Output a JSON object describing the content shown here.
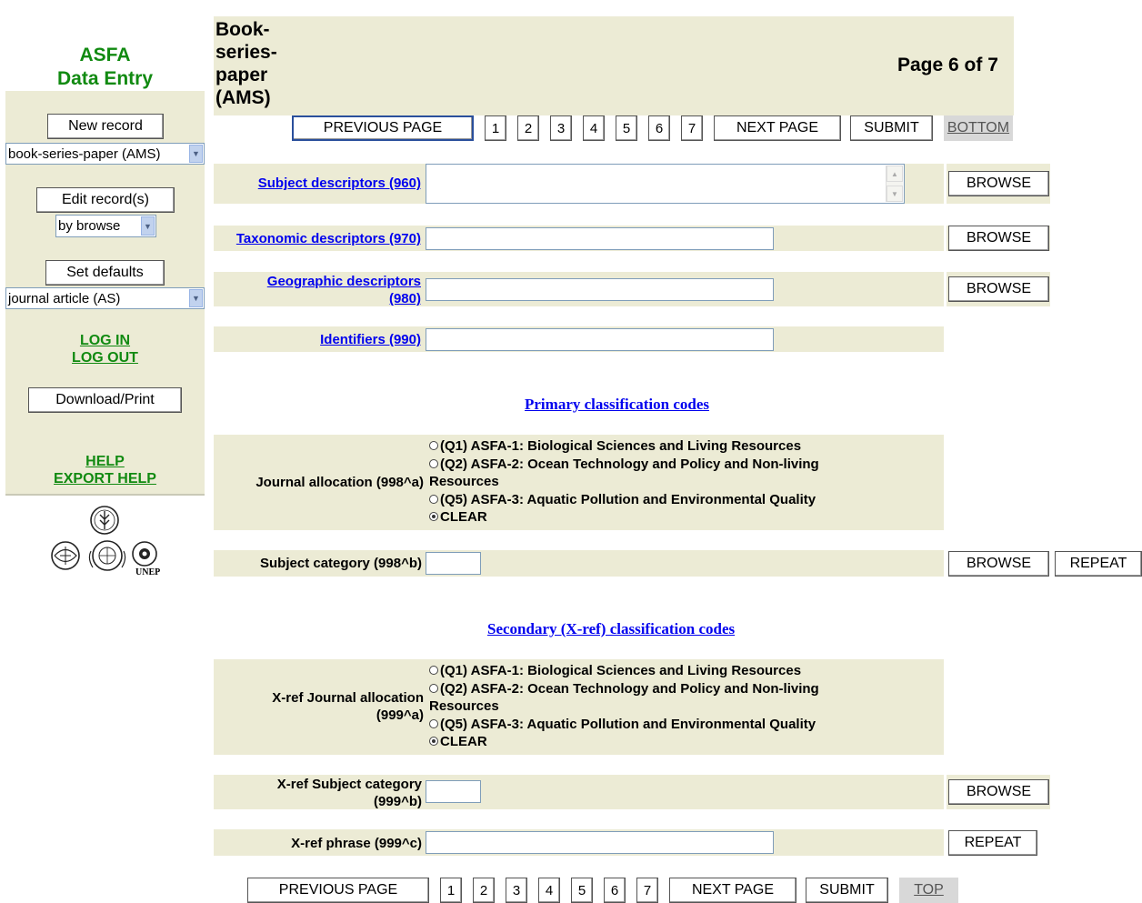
{
  "sidebar": {
    "title_line1": "ASFA",
    "title_line2": "Data Entry",
    "new_record": "New record",
    "record_type_select": "book-series-paper (AMS)",
    "edit_records": "Edit record(s)",
    "edit_mode_select": "by browse",
    "set_defaults": "Set defaults",
    "defaults_select": "journal article (AS)",
    "log_in": "LOG IN",
    "log_out": "LOG OUT",
    "download_print": "Download/Print",
    "help": "HELP",
    "export_help": "EXPORT HELP",
    "logo_text": "UNEP"
  },
  "header": {
    "record_type_title": "Book-\nseries-\npaper\n(AMS)",
    "page_indicator": "Page 6 of 7"
  },
  "nav": {
    "previous": "PREVIOUS PAGE",
    "pages": [
      "1",
      "2",
      "3",
      "4",
      "5",
      "6",
      "7"
    ],
    "next": "NEXT PAGE",
    "submit": "SUBMIT",
    "bottom": "BOTTOM",
    "top": "TOP"
  },
  "fields": {
    "subject_descriptors": "Subject descriptors (960)",
    "taxonomic_descriptors": "Taxonomic descriptors (970)",
    "geographic_descriptors": "Geographic descriptors (980)",
    "identifiers": "Identifiers (990)",
    "browse": "BROWSE",
    "repeat": "REPEAT"
  },
  "primary": {
    "section_title": "Primary classification codes",
    "journal_allocation_label": "Journal allocation (998^a)",
    "subject_category_label": "Subject category (998^b)"
  },
  "secondary": {
    "section_title": "Secondary (X-ref) classification codes",
    "xref_journal_allocation_label": "X-ref Journal allocation (999^a)",
    "xref_subject_category_label": "X-ref Subject category (999^b)",
    "xref_phrase_label": "X-ref phrase (999^c)"
  },
  "radio_options": {
    "q1": "(Q1) ASFA-1: Biological Sciences and Living Resources",
    "q2": "(Q2) ASFA-2: Ocean Technology and Policy and Non-living",
    "q2_cont": "Resources",
    "q5": "(Q5) ASFA-3: Aquatic Pollution and Environmental Quality",
    "clear": "CLEAR",
    "selected": "clear"
  }
}
